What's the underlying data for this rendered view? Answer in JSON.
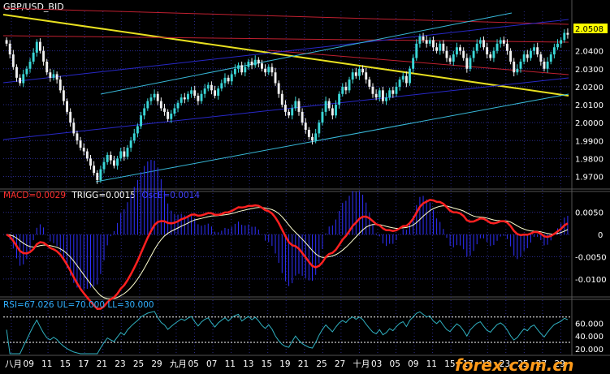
{
  "chart_data": [
    {
      "type": "candlestick",
      "title": "GBP/USD_BID",
      "last_price": "2.0508",
      "ylim": [
        1.963,
        2.062
      ],
      "yticks": [
        "2.0400",
        "2.0300",
        "2.0200",
        "2.0100",
        "2.0000",
        "1.9900",
        "1.9800",
        "1.9700"
      ],
      "close": [
        2.044,
        2.038,
        2.031,
        2.025,
        2.022,
        2.027,
        2.03,
        2.034,
        2.039,
        2.045,
        2.04,
        2.034,
        2.028,
        2.025,
        2.027,
        2.024,
        2.018,
        2.012,
        2.006,
        2.0,
        1.994,
        1.99,
        1.986,
        1.984,
        1.98,
        1.976,
        1.972,
        1.968,
        1.974,
        1.978,
        1.982,
        1.979,
        1.976,
        1.98,
        1.984,
        1.981,
        1.986,
        1.99,
        1.994,
        1.998,
        2.004,
        2.008,
        2.012,
        2.014,
        2.016,
        2.012,
        2.008,
        2.006,
        2.002,
        2.005,
        2.008,
        2.011,
        2.014,
        2.013,
        2.016,
        2.018,
        2.015,
        2.012,
        2.016,
        2.019,
        2.021,
        2.018,
        2.015,
        2.019,
        2.022,
        2.025,
        2.023,
        2.027,
        2.03,
        2.032,
        2.028,
        2.031,
        2.034,
        2.032,
        2.035,
        2.033,
        2.03,
        2.028,
        2.031,
        2.028,
        2.022,
        2.016,
        2.01,
        2.006,
        2.004,
        2.008,
        2.012,
        2.006,
        2.0,
        1.996,
        1.992,
        1.99,
        1.994,
        2.0,
        2.006,
        2.012,
        2.008,
        2.004,
        2.01,
        2.016,
        2.02,
        2.018,
        2.024,
        2.028,
        2.026,
        2.03,
        2.028,
        2.024,
        2.02,
        2.016,
        2.014,
        2.018,
        2.012,
        2.014,
        2.018,
        2.016,
        2.02,
        2.024,
        2.026,
        2.022,
        2.03,
        2.036,
        2.044,
        2.048,
        2.046,
        2.044,
        2.046,
        2.042,
        2.04,
        2.044,
        2.04,
        2.036,
        2.034,
        2.038,
        2.042,
        2.04,
        2.036,
        2.03,
        2.036,
        2.04,
        2.044,
        2.046,
        2.042,
        2.038,
        2.036,
        2.04,
        2.044,
        2.046,
        2.044,
        2.04,
        2.034,
        2.028,
        2.03,
        2.034,
        2.038,
        2.036,
        2.04,
        2.042,
        2.038,
        2.034,
        2.03,
        2.034,
        2.038,
        2.042,
        2.044,
        2.046,
        2.05,
        2.049
      ]
    },
    {
      "type": "line",
      "title_parts": [
        "MACD=0.0029",
        "TRIGG=0.0015",
        "OscE=0.0014"
      ],
      "ylim": [
        -0.0135,
        0.0075
      ],
      "yticks": [
        "0.0050",
        "0",
        "-0.0050",
        "-0.0100"
      ],
      "series_colors": [
        "#ff2020",
        "#ffffd0",
        "#3030ff"
      ]
    },
    {
      "type": "line",
      "title": "RSI=67.026 UL=70.000 LL=30.000",
      "ylim": [
        12,
        80
      ],
      "yticks": [
        "60.000",
        "40.000",
        "20.000"
      ],
      "levels": [
        70,
        30
      ],
      "color": "#30b0c0"
    }
  ],
  "xaxis": {
    "labels": [
      "八月",
      "09",
      "11",
      "15",
      "17",
      "21",
      "23",
      "25",
      "29",
      "九月",
      "05",
      "07",
      "11",
      "13",
      "15",
      "19",
      "21",
      "25",
      "27",
      "十月",
      "03",
      "05",
      "09",
      "11",
      "15",
      "17",
      "19",
      "23",
      "25",
      "27",
      "29"
    ]
  },
  "watermark": "forex.com.cn",
  "colors": {
    "background": "#000000",
    "grid": "#2a2a8a",
    "candle_up": "#3ad6d6",
    "candle_down": "#f0f0f0",
    "trend_yellow": "#e8e020",
    "trend_red": "#c02030",
    "trend_blue": "#2828c8",
    "trend_cyan": "#38b8d8",
    "price_box": "#ffff00"
  }
}
